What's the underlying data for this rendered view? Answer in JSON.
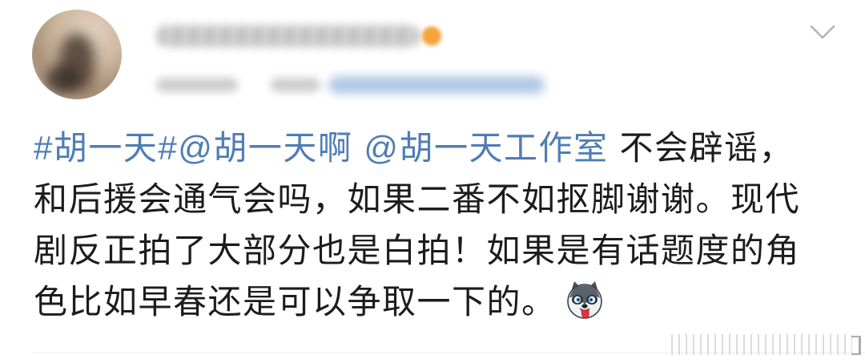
{
  "author": {
    "avatar": "avatar-image",
    "badge_icon": "verified-badge-icon"
  },
  "menu": {
    "icon": "chevron-down-icon"
  },
  "post": {
    "hashtag": "#胡一天#",
    "mention_1": "@胡一天啊",
    "mention_2": "@胡一天工作室",
    "line_1_rest": "不会辟谣，",
    "line_2": "和后援会通气会吗，如果二番不如抠脚谢谢。现代",
    "line_3": "剧反正拍了大部分也是白拍！如果是有话题度的角",
    "line_4": "色比如早春还是可以争取一下的。",
    "emoji": "husky-emoji"
  },
  "colors": {
    "link": "#4f7db6",
    "text": "#1c1c1c",
    "chevron": "#b5b5b5",
    "badge": "#f5a33a",
    "background": "#ffffff"
  }
}
